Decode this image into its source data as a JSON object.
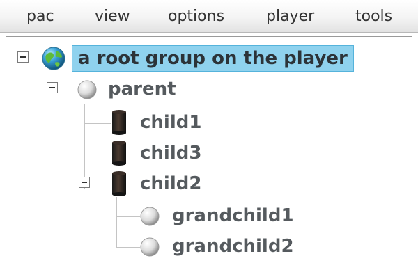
{
  "menu": {
    "items": [
      "pac",
      "view",
      "options",
      "player",
      "tools"
    ]
  },
  "tree": {
    "root": {
      "label": "a root group on the player",
      "icon": "globe-icon",
      "expanded": true
    },
    "parent": {
      "label": "parent",
      "icon": "sphere-icon",
      "expanded": true
    },
    "child1": {
      "label": "child1",
      "icon": "cylinder-icon"
    },
    "child3": {
      "label": "child3",
      "icon": "cylinder-icon"
    },
    "child2": {
      "label": "child2",
      "icon": "cylinder-icon",
      "expanded": true
    },
    "grandchild1": {
      "label": "grandchild1",
      "icon": "sphere-icon"
    },
    "grandchild2": {
      "label": "grandchild2",
      "icon": "sphere-icon"
    }
  },
  "colors": {
    "selection_bg": "#8fd2ee",
    "selection_border": "#55b3db",
    "label_text": "#555a5e"
  }
}
